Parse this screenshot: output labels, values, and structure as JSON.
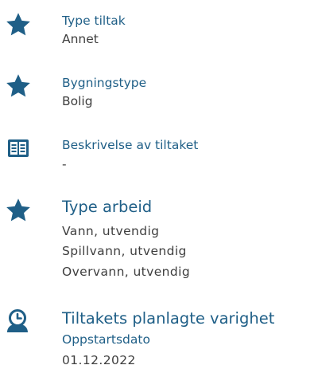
{
  "colors": {
    "heading": "#1f5f87",
    "value": "#3e3e3e",
    "icon": "#1f5f87"
  },
  "items": [
    {
      "icon": "star-icon",
      "heading": "Type tiltak",
      "values": [
        "Annet"
      ]
    },
    {
      "icon": "star-icon",
      "heading": "Bygningstype",
      "values": [
        "Bolig"
      ]
    },
    {
      "icon": "description-icon",
      "heading": "Beskrivelse av tiltaket",
      "values": [
        "-"
      ]
    },
    {
      "icon": "star-icon",
      "heading": "Type arbeid",
      "values": [
        "Vann, utvendig",
        "Spillvann, utvendig",
        "Overvann, utvendig"
      ]
    },
    {
      "icon": "clock-person-icon",
      "heading": "Tiltakets planlagte varighet",
      "subheading": "Oppstartsdato",
      "values": [
        "01.12.2022"
      ]
    }
  ]
}
